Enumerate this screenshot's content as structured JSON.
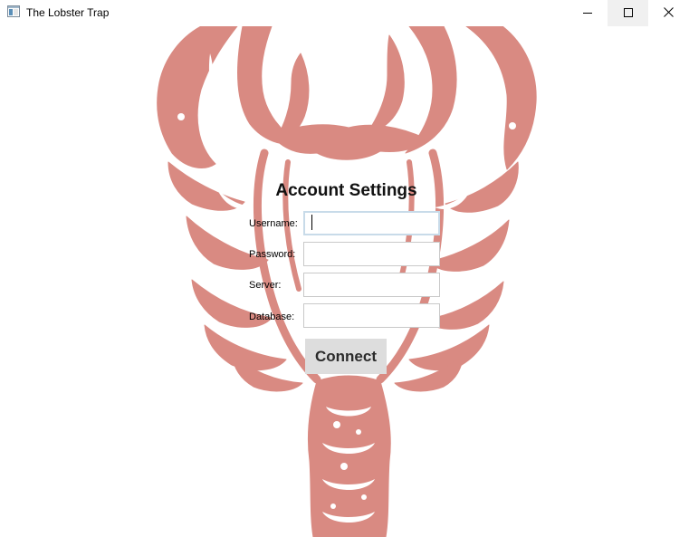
{
  "window": {
    "title": "The Lobster Trap",
    "icon": "app-window-icon",
    "controls": [
      "minimize-icon",
      "maximize-icon",
      "close-icon"
    ]
  },
  "background_image": {
    "subject": "lobster-illustration",
    "color": "#d98a82"
  },
  "form": {
    "heading": "Account Settings",
    "fields": [
      {
        "label": "Username:",
        "value": "",
        "placeholder": "",
        "focused": true
      },
      {
        "label": "Password:",
        "value": "",
        "placeholder": ""
      },
      {
        "label": "Server:",
        "value": "",
        "placeholder": ""
      },
      {
        "label": "Database:",
        "value": "",
        "placeholder": ""
      }
    ],
    "submit_label": "Connect"
  }
}
